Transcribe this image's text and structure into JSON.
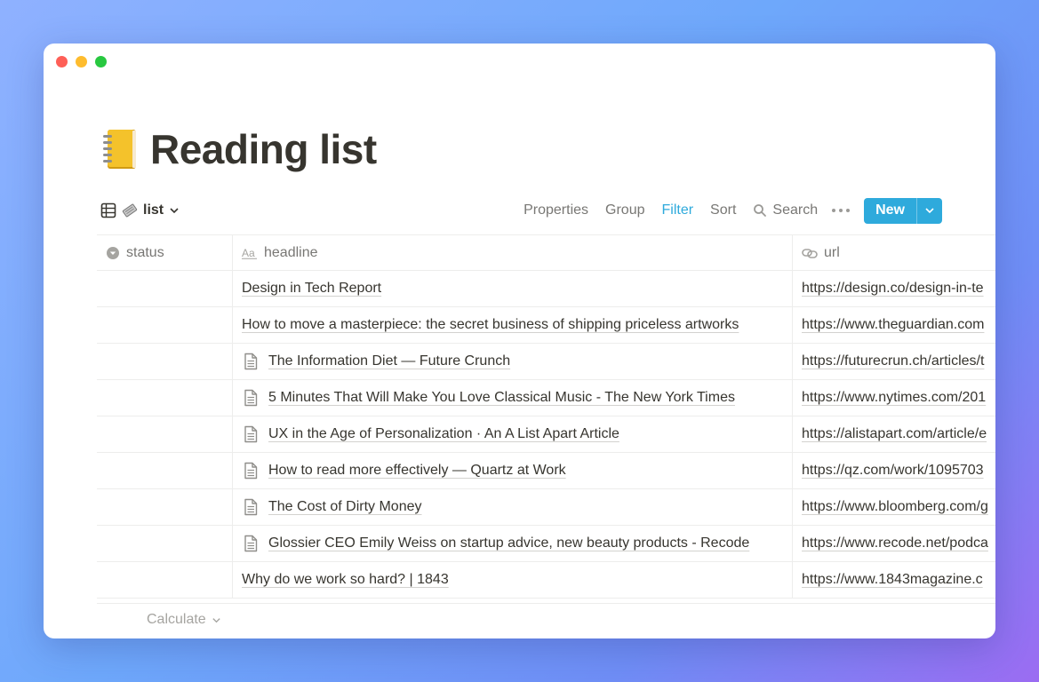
{
  "page": {
    "title": "Reading list",
    "emoji": "notebook-icon"
  },
  "toolbar": {
    "view_label": "list",
    "properties": "Properties",
    "group": "Group",
    "filter": "Filter",
    "sort": "Sort",
    "search": "Search",
    "new": "New",
    "accent_color": "#2eaadc"
  },
  "table": {
    "columns": [
      {
        "label": "status",
        "icon": "select-icon"
      },
      {
        "label": "headline",
        "icon": "text-aa-icon"
      },
      {
        "label": "url",
        "icon": "link-icon"
      }
    ],
    "rows": [
      {
        "headline": "Design in Tech Report",
        "doc": false,
        "url": "https://design.co/design-in-te"
      },
      {
        "headline": "How to move a masterpiece: the secret business of shipping priceless artworks",
        "doc": false,
        "url": "https://www.theguardian.com"
      },
      {
        "headline": "The Information Diet — Future Crunch",
        "doc": true,
        "url": "https://futurecrun.ch/articles/t"
      },
      {
        "headline": "5 Minutes That Will Make You Love Classical Music - The New York Times",
        "doc": true,
        "url": "https://www.nytimes.com/201"
      },
      {
        "headline": "UX in the Age of Personalization · An A List Apart Article",
        "doc": true,
        "url": "https://alistapart.com/article/e"
      },
      {
        "headline": "How to read more effectively — Quartz at Work",
        "doc": true,
        "url": "https://qz.com/work/1095703"
      },
      {
        "headline": "The Cost of Dirty Money",
        "doc": true,
        "url": "https://www.bloomberg.com/g"
      },
      {
        "headline": "Glossier CEO Emily Weiss on startup advice, new beauty products - Recode",
        "doc": true,
        "url": "https://www.recode.net/podca"
      },
      {
        "headline": "Why do we work so hard? | 1843",
        "doc": false,
        "url": "https://www.1843magazine.c"
      }
    ]
  },
  "footer": {
    "calculate": "Calculate"
  }
}
